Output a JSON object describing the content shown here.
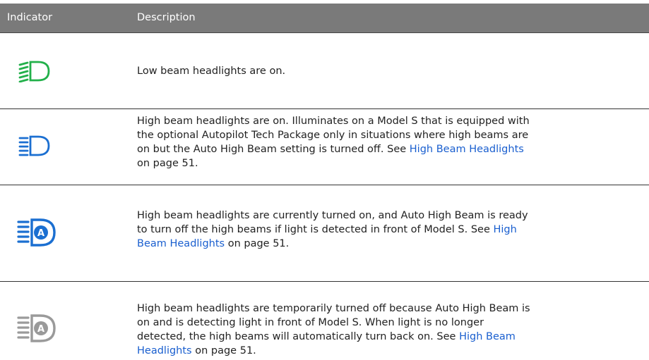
{
  "table": {
    "headers": {
      "indicator": "Indicator",
      "description": "Description"
    },
    "rows": [
      {
        "icon": "low-beam-icon",
        "lines": [
          {
            "text": "Low beam headlights are on."
          }
        ]
      },
      {
        "icon": "high-beam-icon",
        "lines": [
          {
            "text": "High beam headlights are on. Illuminates on a Model S that is equipped with"
          },
          {
            "text": "the optional Autopilot Tech Package only in situations where high beams are"
          },
          {
            "text": "on but the Auto High Beam setting is turned off. See ",
            "link": "High Beam Headlights"
          },
          {
            "text": "on page 51."
          }
        ]
      },
      {
        "icon": "auto-high-beam-on-icon",
        "lines": [
          {
            "text": "High beam headlights are currently turned on, and Auto High Beam is ready"
          },
          {
            "text": "to turn off the high beams if light is detected in front of Model S. See ",
            "link": "High"
          },
          {
            "link_pre": "Beam Headlights",
            "text": " on page 51."
          }
        ]
      },
      {
        "icon": "auto-high-beam-off-icon",
        "lines": [
          {
            "text": "High beam headlights are temporarily turned off because Auto High Beam is"
          },
          {
            "text": "on and is detecting light in front of Model S. When light is no longer"
          },
          {
            "text": "detected, the high beams will automatically turn back on. See ",
            "link": "High Beam"
          },
          {
            "link_pre": "Headlights",
            "text": " on page 51."
          }
        ]
      }
    ]
  },
  "colors": {
    "header_bg": "#7a7a7a",
    "low_beam_green": "#22b04a",
    "high_beam_blue": "#1b6fd1",
    "auto_gray": "#9a9a9a",
    "link_blue": "#1a5fcf"
  }
}
